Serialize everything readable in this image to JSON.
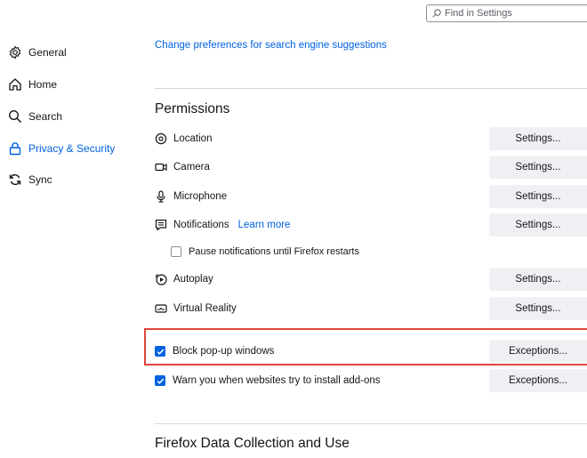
{
  "search": {
    "placeholder": "Find in Settings"
  },
  "sidebar": {
    "items": [
      {
        "label": "General",
        "icon": "gear-icon",
        "selected": false
      },
      {
        "label": "Home",
        "icon": "home-icon",
        "selected": false
      },
      {
        "label": "Search",
        "icon": "search-icon",
        "selected": false
      },
      {
        "label": "Privacy & Security",
        "icon": "lock-icon",
        "selected": true
      },
      {
        "label": "Sync",
        "icon": "sync-icon",
        "selected": false
      }
    ]
  },
  "main": {
    "search_suggestions_link": "Change preferences for search engine suggestions",
    "permissions": {
      "title": "Permissions",
      "rows": [
        {
          "label": "Location",
          "icon": "location-icon",
          "button": "Settings..."
        },
        {
          "label": "Camera",
          "icon": "camera-icon",
          "button": "Settings..."
        },
        {
          "label": "Microphone",
          "icon": "microphone-icon",
          "button": "Settings..."
        },
        {
          "label": "Notifications",
          "icon": "notifications-icon",
          "button": "Settings...",
          "link": "Learn more"
        },
        {
          "label": "Autoplay",
          "icon": "autoplay-icon",
          "button": "Settings..."
        },
        {
          "label": "Virtual Reality",
          "icon": "vr-icon",
          "button": "Settings..."
        }
      ],
      "pause_notifications": {
        "label": "Pause notifications until Firefox restarts",
        "checked": false
      },
      "block_popups": {
        "label": "Block pop-up windows",
        "checked": true,
        "button": "Exceptions..."
      },
      "warn_addons": {
        "label": "Warn you when websites try to install add-ons",
        "checked": true,
        "button": "Exceptions..."
      }
    },
    "data_collection": {
      "title": "Firefox Data Collection and Use"
    }
  },
  "colors": {
    "accent": "#0061e0",
    "highlight": "#e0463c",
    "button_bg": "#f0f0f4"
  }
}
